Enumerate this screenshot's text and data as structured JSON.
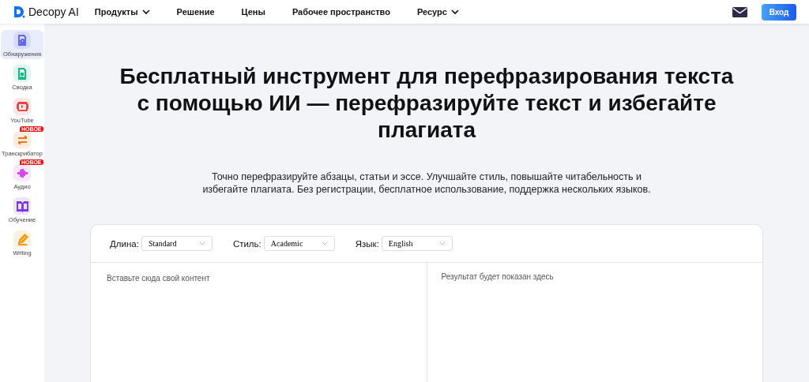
{
  "header": {
    "logo": "Decopy AI",
    "nav": [
      {
        "label": "Продукты",
        "dropdown": true
      },
      {
        "label": "Решение",
        "dropdown": false
      },
      {
        "label": "Цены",
        "dropdown": false
      },
      {
        "label": "Рабочее пространство",
        "dropdown": false
      },
      {
        "label": "Ресурс",
        "dropdown": true
      }
    ],
    "login": "Вход"
  },
  "sidebar": {
    "items": [
      {
        "label": "Обнаружения",
        "kind": "detect",
        "selected": true,
        "color": "#6366f1"
      },
      {
        "label": "Сводка",
        "kind": "doc",
        "selected": false,
        "color": "#10b981"
      },
      {
        "label": "YouTube",
        "kind": "video",
        "selected": false,
        "color": "#ef4444"
      },
      {
        "label": "Транскрибатор",
        "kind": "swap",
        "selected": false,
        "color": "#f97316",
        "badge": "НОВОЕ"
      },
      {
        "label": "Аудио",
        "kind": "audio",
        "selected": false,
        "color": "#d946ef",
        "badge": "НОВОЕ"
      },
      {
        "label": "Обучение",
        "kind": "book",
        "selected": false,
        "color": "#7c3aed"
      },
      {
        "label": "Writing",
        "kind": "pen",
        "selected": false,
        "color": "#f59e0b"
      }
    ]
  },
  "hero": {
    "title": "Бесплатный инструмент для перефразирования текста с помощью ИИ — перефразируйте текст и избегайте плагиата",
    "subtitle": "Точно перефразируйте абзацы, статьи и эссе. Улучшайте стиль, повышайте читабельность и избегайте плагиата. Без регистрации, бесплатное использование, поддержка нескольких языков."
  },
  "tool": {
    "options": [
      {
        "label": "Длина:",
        "value": "Standard"
      },
      {
        "label": "Стиль:",
        "value": "Academic"
      },
      {
        "label": "Язык:",
        "value": "English"
      }
    ],
    "input": {
      "placeholder": "Вставьте сюда свой контент"
    },
    "output": {
      "placeholder": "Результат будет показан здесь"
    }
  }
}
